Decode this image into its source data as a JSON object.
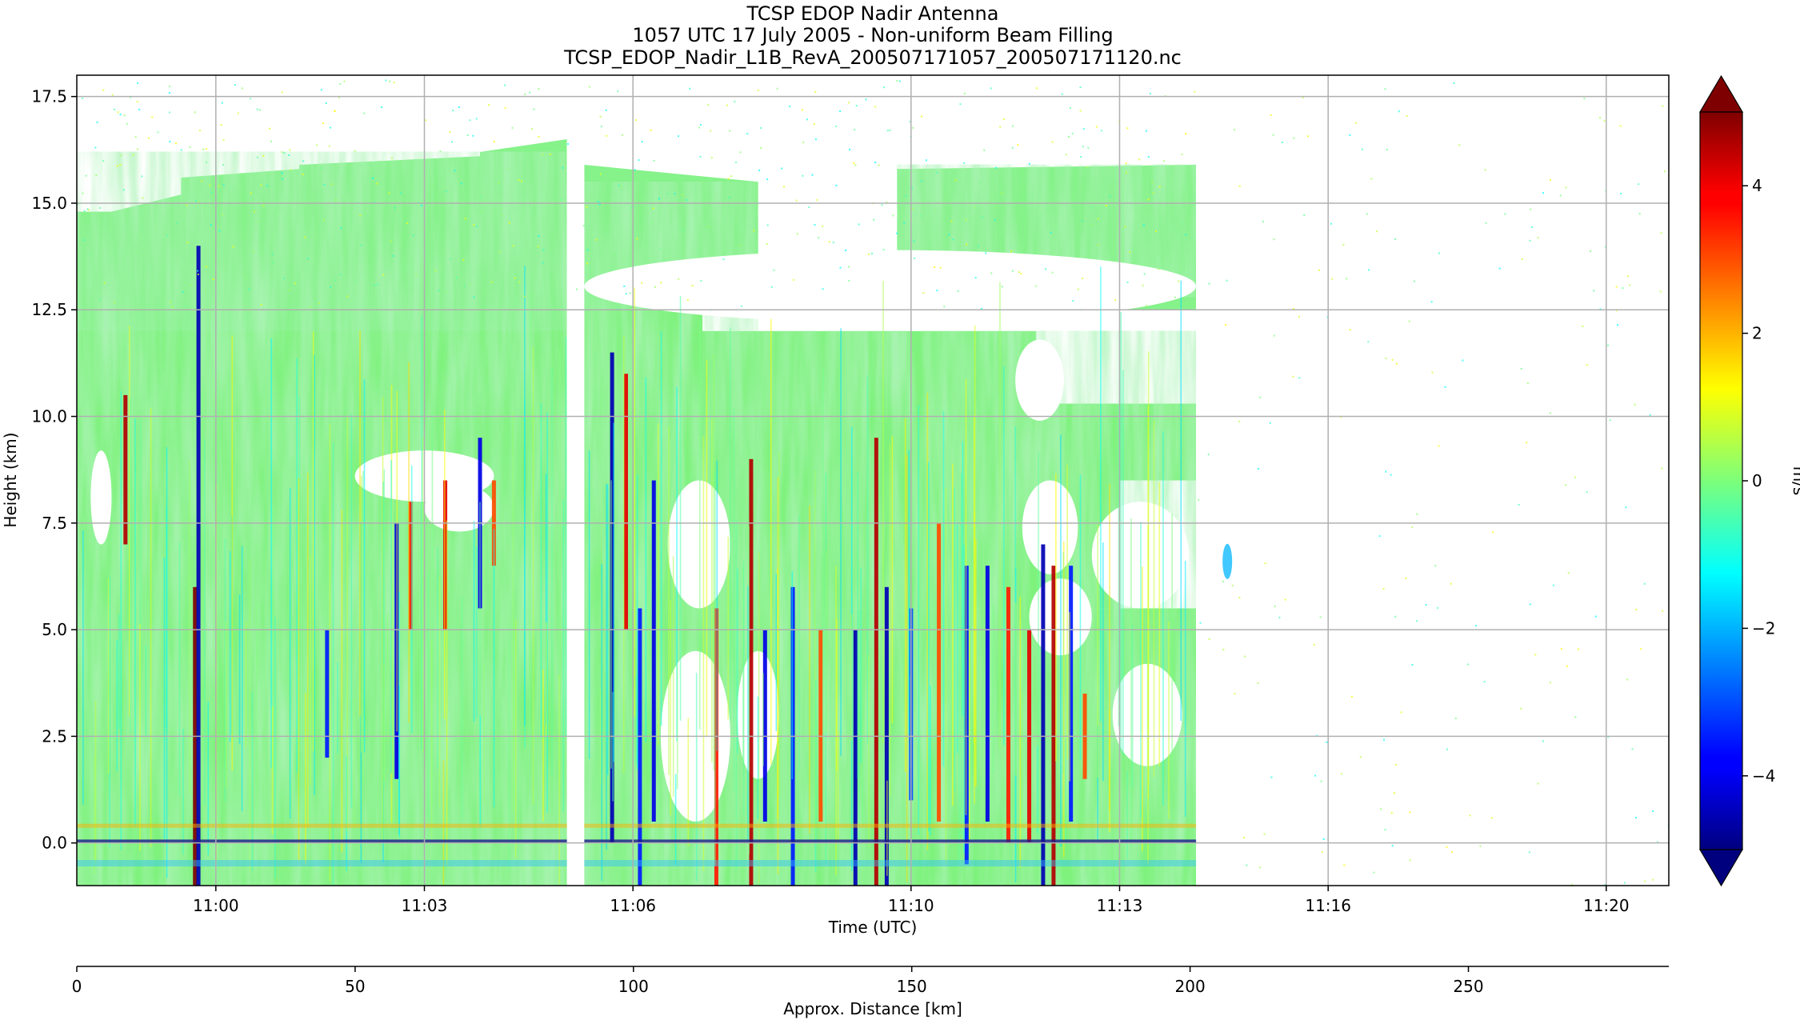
{
  "title_lines": [
    "TCSP EDOP Nadir Antenna",
    "1057 UTC 17 July 2005 - Non-uniform Beam Filling",
    "TCSP_EDOP_Nadir_L1B_RevA_200507171057_200507171120.nc"
  ],
  "chart_data": {
    "type": "heatmap",
    "xlabel": "Time (UTC)",
    "ylabel": "Height (km)",
    "x_tick_labels": [
      "11:00",
      "11:03",
      "11:06",
      "11:10",
      "11:13",
      "11:16",
      "11:20"
    ],
    "x_tick_minutes": [
      60.0,
      63.0,
      66.0,
      70.0,
      73.0,
      76.0,
      80.0
    ],
    "xlim_minutes": [
      58.0,
      80.9
    ],
    "y_ticks": [
      0.0,
      2.5,
      5.0,
      7.5,
      10.0,
      12.5,
      15.0,
      17.5
    ],
    "y_tick_labels": [
      "0.0",
      "2.5",
      "5.0",
      "7.5",
      "10.0",
      "12.5",
      "15.0",
      "17.5"
    ],
    "ylim": [
      -1.0,
      18.0
    ],
    "secondary_axis": {
      "xlabel": "Approx. Distance [km]",
      "ticks": [
        0,
        50,
        100,
        150,
        200,
        250
      ],
      "tick_labels": [
        "0",
        "50",
        "100",
        "150",
        "200",
        "250"
      ],
      "xlim": [
        0,
        286
      ]
    },
    "colorbar": {
      "label": "m/s",
      "colormap": "jet",
      "range": [
        -5,
        5
      ],
      "ticks": [
        -4,
        -2,
        0,
        2,
        4
      ],
      "tick_labels": [
        "−4",
        "−2",
        "0",
        "2",
        "4"
      ],
      "extend": "both"
    },
    "data_gap_minutes": [
      65.05,
      65.3
    ],
    "data_end_minute": 74.1,
    "grid": true
  }
}
